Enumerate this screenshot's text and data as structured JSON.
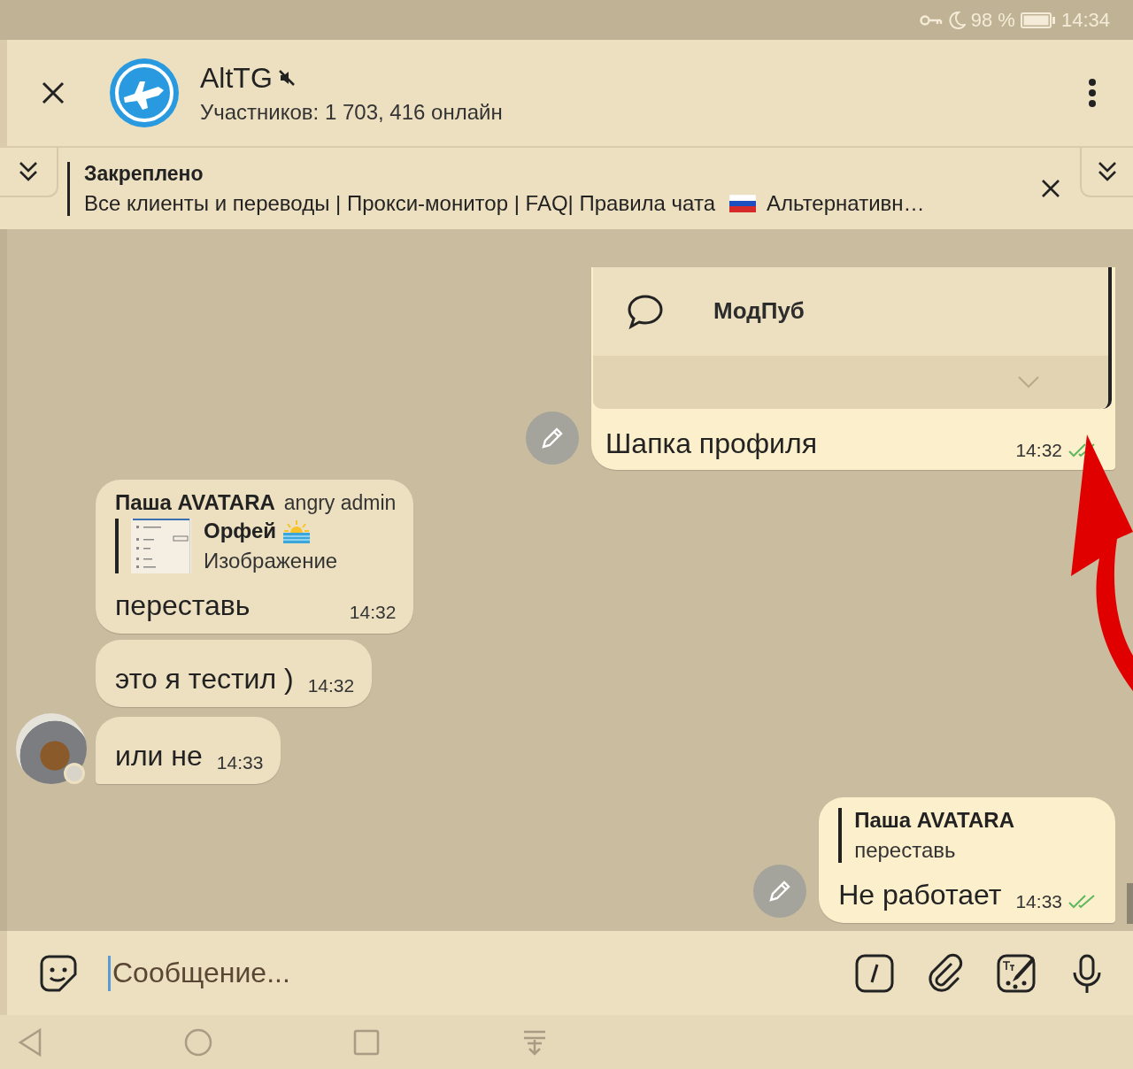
{
  "status_bar": {
    "battery": "98 %",
    "time": "14:34"
  },
  "header": {
    "title": "AltTG",
    "muted": true,
    "subtitle": "Участников: 1 703, 416 онлайн"
  },
  "pinned": {
    "label": "Закреплено",
    "text": "Все клиенты и переводы | Прокси-монитор | FAQ| Правила чата",
    "text_after_flag": "Альтернативн…"
  },
  "messages": [
    {
      "kind": "outgoing",
      "embedded_item": "МодПуб",
      "text": "Шапка профиля",
      "time": "14:32",
      "read": true
    },
    {
      "kind": "incoming",
      "sender": "Паша AVATARA",
      "sender_title": "angry admin",
      "reply": {
        "kind": "image",
        "author": "Орфей",
        "text": "Изображение"
      },
      "text": "переставь",
      "time": "14:32",
      "avatar": false
    },
    {
      "kind": "incoming",
      "text": "это я тестил )",
      "time": "14:32",
      "avatar": false
    },
    {
      "kind": "incoming",
      "text": "или не",
      "time": "14:33",
      "avatar": true
    },
    {
      "kind": "outgoing",
      "reply": {
        "kind": "text",
        "author": "Паша AVATARA",
        "text": "переставь"
      },
      "text": "Не работает",
      "time": "14:33",
      "read": true
    }
  ],
  "composer": {
    "placeholder": "Сообщение..."
  }
}
